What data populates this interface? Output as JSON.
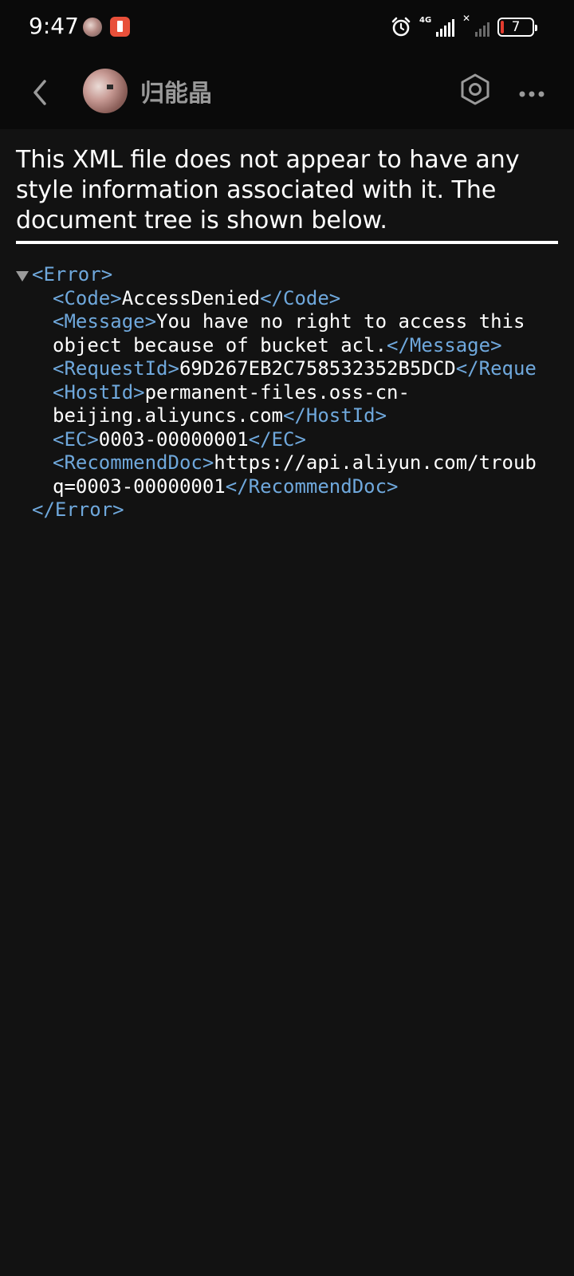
{
  "status_bar": {
    "time": "9:47",
    "network": "4G",
    "battery_level": "7"
  },
  "app_bar": {
    "title": "归能晶"
  },
  "notice": {
    "text": "This XML file does not appear to have any style information associated with it. The document tree is shown below."
  },
  "xml": {
    "root_open": "<Error>",
    "root_close": "</Error>",
    "code_open": "<Code>",
    "code_value": "AccessDenied",
    "code_close": "</Code>",
    "message_open": "<Message>",
    "message_value_line1": "You have no right to access this",
    "message_value_line2": "object because of bucket acl.",
    "message_close": "</Message>",
    "requestid_open": "<RequestId>",
    "requestid_value": "69D267EB2C758532352B5DCD",
    "requestid_close_visible": "</Reque",
    "hostid_open": "<HostId>",
    "hostid_value_line1": "permanent-files.oss-cn-",
    "hostid_value_line2": "beijing.aliyuncs.com",
    "hostid_close": "</HostId>",
    "ec_open": "<EC>",
    "ec_value": "0003-00000001",
    "ec_close": "</EC>",
    "recdoc_open": "<RecommendDoc>",
    "recdoc_value_line1": "https://api.aliyun.com/troub",
    "recdoc_value_line2": "q=0003-00000001",
    "recdoc_close": "</RecommendDoc>"
  },
  "colors": {
    "background": "#121212",
    "bar_background": "#0a0a0a",
    "tag": "#6fa8dc",
    "text": "#ffffff",
    "battery_low": "#e33b2e"
  }
}
